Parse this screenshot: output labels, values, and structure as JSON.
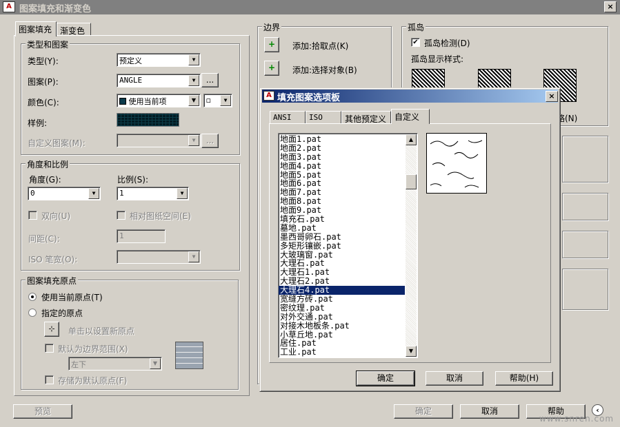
{
  "window": {
    "title": "图案填充和渐变色",
    "close": "×"
  },
  "tabs": [
    "图案填充",
    "渐变色"
  ],
  "type_pattern": {
    "group": "类型和图案",
    "type_label": "类型(Y):",
    "type_value": "预定义",
    "pattern_label": "图案(P):",
    "pattern_value": "ANGLE",
    "color_label": "颜色(C):",
    "color_value": "使用当前项",
    "swatch_label": "样例:",
    "custom_label": "自定义图案(M):",
    "ellipsis": "..."
  },
  "angle_scale": {
    "group": "角度和比例",
    "angle_label": "角度(G):",
    "angle_value": "0",
    "scale_label": "比例(S):",
    "scale_value": "1",
    "double_label": "双向(U)",
    "relative_label": "相对图纸空间(E)",
    "spacing_label": "间距(C):",
    "spacing_value": "1",
    "iso_label": "ISO 笔宽(O):"
  },
  "origin": {
    "group": "图案填充原点",
    "use_current": "使用当前原点(T)",
    "specified": "指定的原点",
    "click_set": "单击以设置新原点",
    "default_extent": "默认为边界范围(X)",
    "position_value": "左下",
    "store_default": "存储为默认原点(F)"
  },
  "boundary": {
    "group": "边界",
    "add_pick": "添加:拾取点(K)",
    "add_select": "添加:选择对象(B)"
  },
  "islands": {
    "group": "孤岛",
    "detect": "孤岛检测(D)",
    "style_label": "孤岛显示样式:",
    "ignore": "忽略(N)"
  },
  "bottom": {
    "preview": "预览",
    "ok": "确定",
    "cancel": "取消",
    "help": "帮助"
  },
  "palette": {
    "title": "填充图案选项板",
    "tabs": [
      "ANSI",
      "ISO",
      "其他预定义",
      "自定义"
    ],
    "active_tab": "自定义",
    "items": [
      "地面1.pat",
      "地面2.pat",
      "地面3.pat",
      "地面4.pat",
      "地面5.pat",
      "地面6.pat",
      "地面7.pat",
      "地面8.pat",
      "地面9.pat",
      "填充石.pat",
      "墓地.pat",
      "墨西哥卵石.pat",
      "多矩形镶嵌.pat",
      "大玻璃窗.pat",
      "大理石.pat",
      "大理石1.pat",
      "大理石2.pat",
      "大理石4.pat",
      "宽缝方砖.pat",
      "密纹理.pat",
      "对外交通.pat",
      "对接木地板条.pat",
      "小草丘地.pat",
      "居住.pat",
      "工业.pat"
    ],
    "selected": "大理石4.pat",
    "ok": "确定",
    "cancel": "取消",
    "help": "帮助(H)"
  },
  "watermark": "www.snren.com",
  "colors": {
    "selection": "#0a246a",
    "face": "#d4d0c8"
  }
}
